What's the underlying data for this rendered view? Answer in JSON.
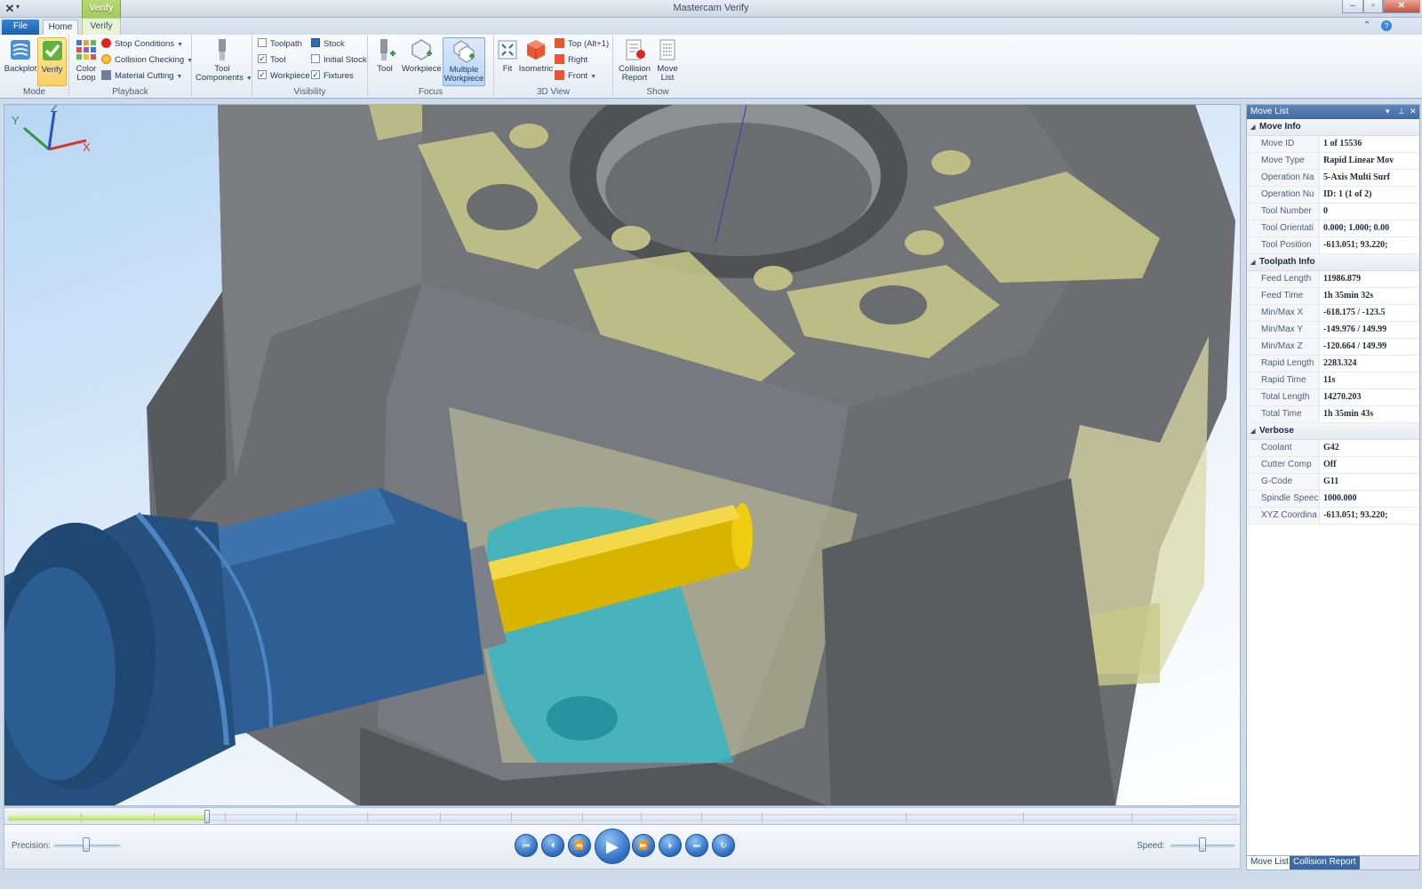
{
  "window": {
    "title": "Mastercam Verify",
    "context_tab": "Verify"
  },
  "tabs": {
    "file": "File",
    "home": "Home",
    "verify": "Verify"
  },
  "ribbon": {
    "mode": {
      "label": "Mode",
      "backplot": "Backplot",
      "verify": "Verify"
    },
    "playback": {
      "label": "Playback",
      "color_loop": "Color Loop",
      "stop_conditions": "Stop Conditions",
      "collision_checking": "Collision Checking",
      "material_cutting": "Material Cutting"
    },
    "tool_components": "Tool Components",
    "visibility": {
      "label": "Visibility",
      "toolpath": "Toolpath",
      "tool": "Tool",
      "workpiece": "Workpiece",
      "stock": "Stock",
      "initial_stock": "Initial Stock",
      "fixtures": "Fixtures"
    },
    "focus": {
      "label": "Focus",
      "tool": "Tool",
      "workpiece": "Workpiece",
      "multiple_workpiece": "Multiple Workpiece"
    },
    "view3d": {
      "label": "3D View",
      "fit": "Fit",
      "isometric": "Isometric",
      "top": "Top (Alt+1)",
      "right": "Right",
      "front": "Front"
    },
    "show": {
      "label": "Show",
      "collision_report": "Collision Report",
      "move_list": "Move List"
    }
  },
  "viewport": {
    "axis_x": "X",
    "axis_y": "Y",
    "axis_z": "Z"
  },
  "playback": {
    "precision_label": "Precision:",
    "speed_label": "Speed:",
    "progress": 0.16
  },
  "panel": {
    "title": "Move List",
    "move_info": {
      "heading": "Move Info",
      "rows": [
        {
          "k": "Move ID",
          "v": "1 of 15536"
        },
        {
          "k": "Move Type",
          "v": "Rapid Linear Mov"
        },
        {
          "k": "Operation Na",
          "v": "5-Axis Multi Surf"
        },
        {
          "k": "Operation Nu",
          "v": "ID: 1 (1 of 2)"
        },
        {
          "k": "Tool Number",
          "v": "0"
        },
        {
          "k": "Tool Orientati",
          "v": "0.000; 1.000; 0.00"
        },
        {
          "k": "Tool Position",
          "v": "-613.051; 93.220;"
        }
      ]
    },
    "toolpath_info": {
      "heading": "Toolpath Info",
      "rows": [
        {
          "k": "Feed Length",
          "v": "11986.879"
        },
        {
          "k": "Feed Time",
          "v": "1h 35min 32s"
        },
        {
          "k": "Min/Max X",
          "v": "-618.175 / -123.5"
        },
        {
          "k": "Min/Max Y",
          "v": "-149.976 / 149.99"
        },
        {
          "k": "Min/Max Z",
          "v": "-120.664 / 149.99"
        },
        {
          "k": "Rapid Length",
          "v": "2283.324"
        },
        {
          "k": "Rapid Time",
          "v": "11s"
        },
        {
          "k": "Total Length",
          "v": "14270.203"
        },
        {
          "k": "Total Time",
          "v": "1h 35min 43s"
        }
      ]
    },
    "verbose": {
      "heading": "Verbose",
      "rows": [
        {
          "k": "Coolant",
          "v": "G42"
        },
        {
          "k": "Cutter Comp",
          "v": "Off"
        },
        {
          "k": "G-Code",
          "v": "G11"
        },
        {
          "k": "Spindle Speec",
          "v": "1000.000"
        },
        {
          "k": "XYZ Coordina",
          "v": "-613.051; 93.220;"
        }
      ]
    },
    "tabs": {
      "move_list": "Move List",
      "collision_report": "Collision Report"
    }
  }
}
